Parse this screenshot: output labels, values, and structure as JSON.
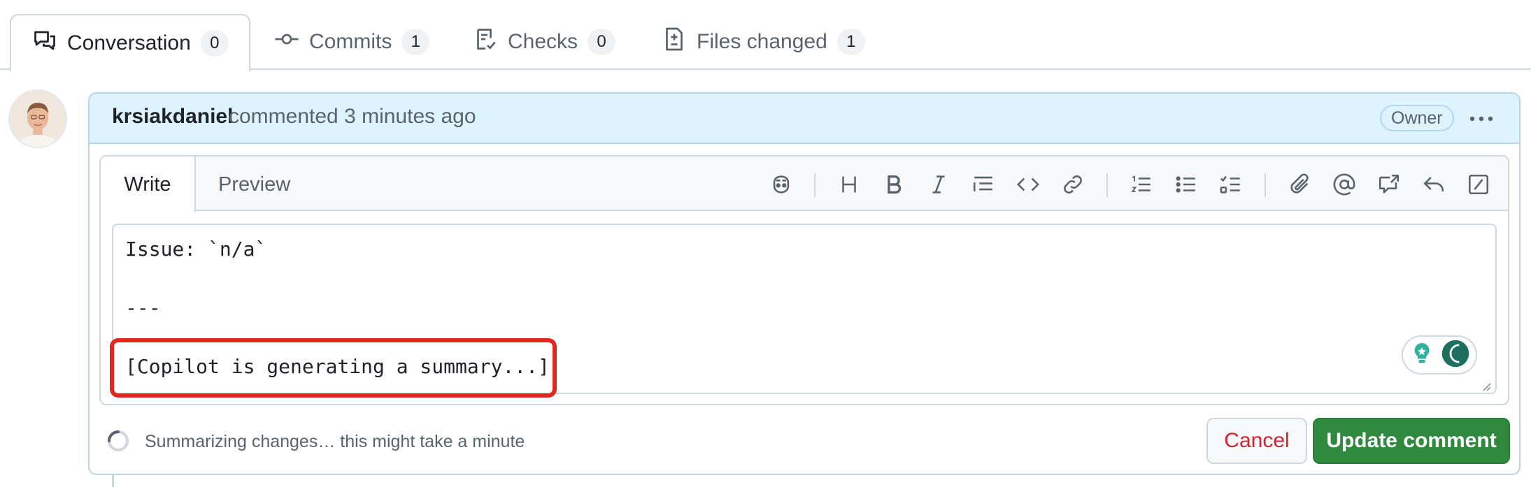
{
  "tabs": [
    {
      "label": "Conversation",
      "count": "0",
      "icon": "comment-discussion-icon",
      "active": true
    },
    {
      "label": "Commits",
      "count": "1",
      "icon": "git-commit-icon",
      "active": false
    },
    {
      "label": "Checks",
      "count": "0",
      "icon": "checklist-icon",
      "active": false
    },
    {
      "label": "Files changed",
      "count": "1",
      "icon": "file-diff-icon",
      "active": false
    }
  ],
  "comment": {
    "author": "krsiakdaniel",
    "meta": "commented 3 minutes ago",
    "badge": "Owner",
    "menu_icon": "kebab-horizontal-icon"
  },
  "editor": {
    "write_tab": "Write",
    "preview_tab": "Preview",
    "toolbar_icons": [
      "copilot-icon",
      "heading-icon",
      "bold-icon",
      "italic-icon",
      "quote-icon",
      "code-icon",
      "link-icon",
      "ordered-list-icon",
      "unordered-list-icon",
      "task-list-icon",
      "attach-icon",
      "mention-icon",
      "cross-reference-icon",
      "reply-icon",
      "slash-command-icon"
    ],
    "lines": [
      "Issue: `n/a`",
      "---",
      "[Copilot is generating a summary...]"
    ]
  },
  "footer": {
    "status": "Summarizing changes… this might take a minute",
    "cancel_label": "Cancel",
    "update_label": "Update comment"
  },
  "colors": {
    "accent_blue_bg": "#ddf4ff",
    "accent_blue_border": "#b6d5f2",
    "primary_green": "#2f8a3e",
    "danger_red": "#d1242f",
    "highlight_red": "#e0281f"
  }
}
